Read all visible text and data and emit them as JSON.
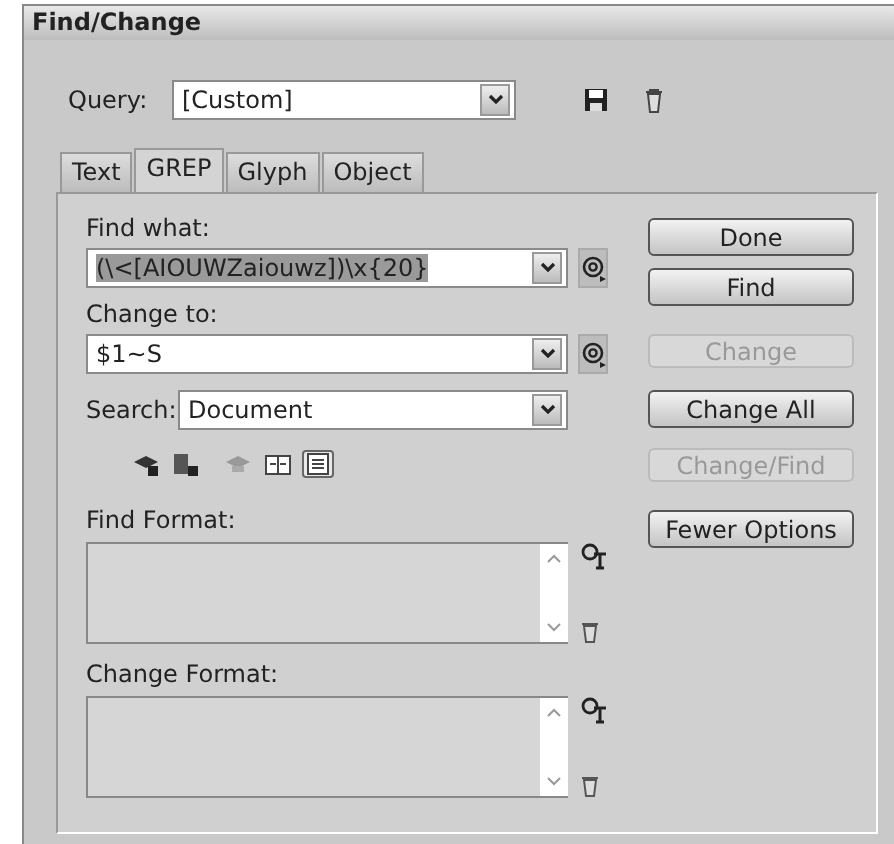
{
  "window": {
    "title": "Find/Change"
  },
  "query": {
    "label": "Query:",
    "value": "[Custom]"
  },
  "tabs": [
    {
      "label": "Text",
      "selected": false
    },
    {
      "label": "GREP",
      "selected": true
    },
    {
      "label": "Glyph",
      "selected": false
    },
    {
      "label": "Object",
      "selected": false
    }
  ],
  "find_what": {
    "label": "Find what:",
    "value": "(\\<[AIOUWZaiouwz])\\x{20}",
    "text_selected": true
  },
  "change_to": {
    "label": "Change to:",
    "value": "$1~S",
    "text_selected": false
  },
  "search": {
    "label": "Search:",
    "value": "Document"
  },
  "options": [
    {
      "on": false
    },
    {
      "on": false
    },
    {
      "on": false
    },
    {
      "on": false
    },
    {
      "on": true
    }
  ],
  "buttons": [
    {
      "label": "Done",
      "disabled": false
    },
    {
      "label": "Find",
      "disabled": false
    },
    {
      "label": "Change",
      "disabled": true
    },
    {
      "label": "Change All",
      "disabled": false
    },
    {
      "label": "Change/Find",
      "disabled": true
    },
    {
      "label": "Fewer Options",
      "disabled": false
    }
  ],
  "find_format": {
    "label": "Find Format:"
  },
  "change_format": {
    "label": "Change Format:"
  }
}
